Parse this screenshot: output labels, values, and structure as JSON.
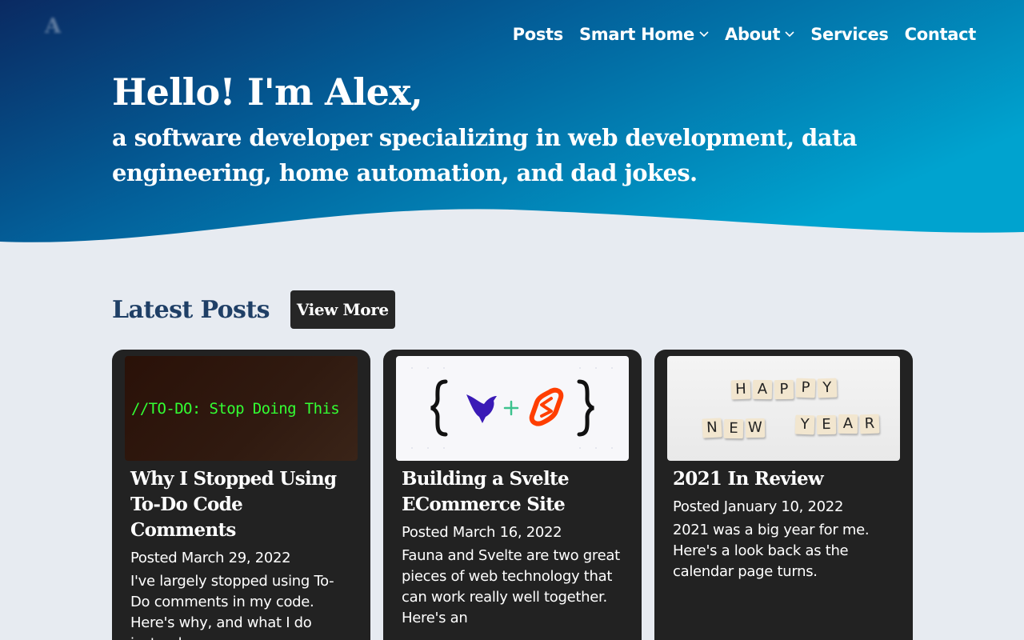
{
  "logo": {
    "text": "A"
  },
  "nav": {
    "items": [
      {
        "label": "Posts",
        "has_dropdown": false
      },
      {
        "label": "Smart Home",
        "has_dropdown": true
      },
      {
        "label": "About",
        "has_dropdown": true
      },
      {
        "label": "Services",
        "has_dropdown": false
      },
      {
        "label": "Contact",
        "has_dropdown": false
      }
    ]
  },
  "hero": {
    "title": "Hello! I'm Alex,",
    "subtitle": "a software developer specializing in web development, data engineering, home automation, and dad jokes."
  },
  "latest": {
    "title": "Latest Posts",
    "view_more": "View More"
  },
  "posts": [
    {
      "image_text": "//TO-DO: Stop Doing This",
      "title": "Why I Stopped Using To-Do Code Comments",
      "date": "Posted March 29, 2022",
      "description": "I've largely stopped using To-Do comments in my code. Here's why, and what I do instead."
    },
    {
      "image_text": "",
      "title": "Building a Svelte ECommerce Site",
      "date": "Posted March 16, 2022",
      "description": "Fauna and Svelte are two great pieces of web technology that can work really well together. Here's an"
    },
    {
      "image_text": "HAPPY NEW YEAR",
      "title": "2021 In Review",
      "date": "Posted January 10, 2022",
      "description": "2021 was a big year for me. Here's a look back as the calendar page turns."
    }
  ],
  "colors": {
    "hero_dark": "#0a2a62",
    "hero_light": "#00a3cf",
    "page_bg": "#e7ebf1",
    "card_bg": "#222222",
    "heading": "#1f3f66",
    "svelte_orange": "#ff3e00",
    "fauna_purple": "#3a1ab6"
  }
}
